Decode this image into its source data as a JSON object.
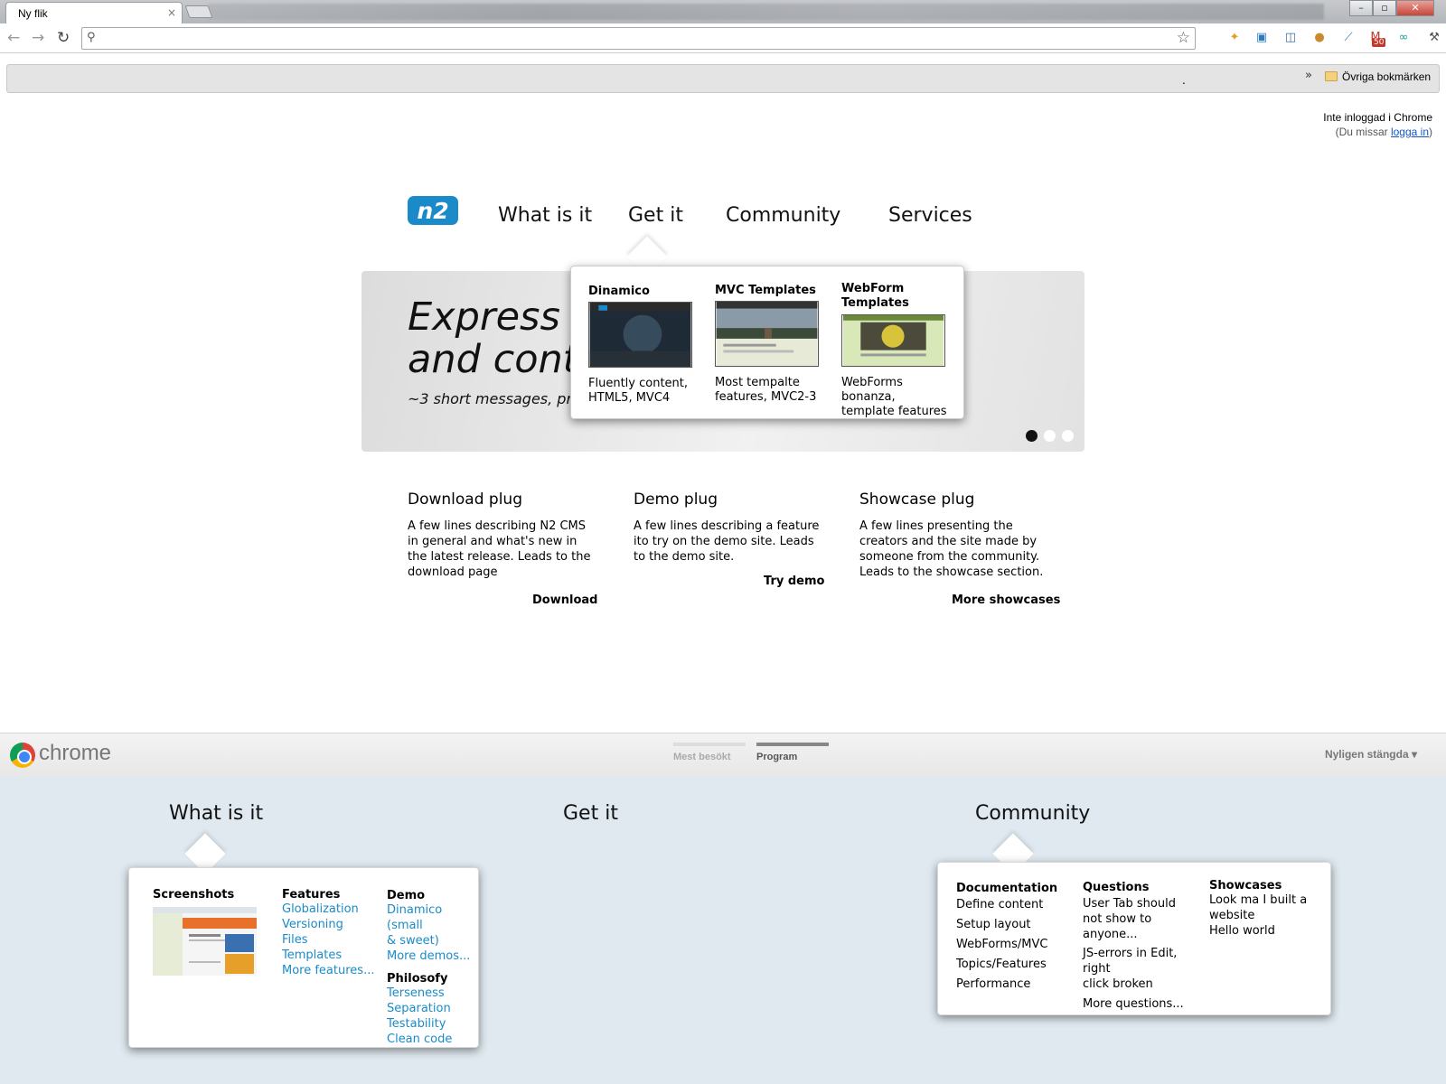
{
  "browser": {
    "tab_title": "Ny flik",
    "tab_close": "×",
    "window_buttons": {
      "minimize": "–",
      "maximize": "▫",
      "close": "✕"
    },
    "omnibox_value": "",
    "bookmarks": {
      "chevron": "»",
      "dot": ".",
      "other": "Övriga bokmärken"
    },
    "signin": {
      "line1": "Inte inloggad i Chrome",
      "line2_prefix": "(Du missar ",
      "link": "logga in",
      "line2_suffix": ")"
    },
    "extensions": [
      {
        "icon": "puzzle-icon",
        "color": "#e0a020"
      },
      {
        "icon": "screen-icon",
        "color": "#2a7cc7"
      },
      {
        "icon": "window-icon",
        "color": "#3a6ea5"
      },
      {
        "icon": "cookie-icon",
        "color": "#c98a2e"
      },
      {
        "icon": "eyedropper-icon",
        "color": "#3b7bbf"
      },
      {
        "icon": "gmail-icon",
        "color": "#c0392b",
        "badge": "50"
      },
      {
        "icon": "readlater-icon",
        "color": "#19a0a0"
      },
      {
        "icon": "wrench-icon",
        "color": "#555555"
      }
    ]
  },
  "mockup": {
    "logo_text": "n2",
    "nav": [
      "What is it",
      "Get it",
      "Community",
      "Services"
    ],
    "hero": {
      "title_line1": "Express y",
      "title_line2": "and cont",
      "subtitle": "~3 short messages, prob"
    },
    "get_it_menu": [
      {
        "title": "Dinamico",
        "text1": "Fluently content,",
        "text2": "HTML5, MVC4"
      },
      {
        "title": "MVC Templates",
        "text1": "Most tempalte",
        "text2": "features, MVC2-3"
      },
      {
        "title1": "WebForm",
        "title2": "Templates",
        "text1": "WebForms bonanza,",
        "text2": "template features"
      }
    ],
    "plugs": [
      {
        "title": "Download plug",
        "text": "A few lines describing N2 CMS in general and what's new in the latest release. Leads to the download page",
        "link": "Download"
      },
      {
        "title": "Demo plug",
        "text": "A few lines describing a feature ito try on the demo site. Leads to the demo site.",
        "link": "Try demo"
      },
      {
        "title": "Showcase plug",
        "text": "A few lines presenting the creators and the site made by someone from the community. Leads to the showcase section.",
        "link": "More showcases"
      }
    ]
  },
  "ntp": {
    "brand": "chrome",
    "tabs": [
      "Mest besökt",
      "Program"
    ],
    "recently_closed": "Nyligen stängda ▾"
  },
  "lower": {
    "nav": [
      "What is it",
      "Get it",
      "Community"
    ],
    "what_menu": {
      "screenshots": "Screenshots",
      "features_title": "Features",
      "features": [
        "Globalization",
        "Versioning",
        "Files",
        "Templates",
        "More features..."
      ],
      "demo_title": "Demo",
      "demo": [
        "Dinamico (small",
        "& sweet)",
        "More demos..."
      ],
      "philosofy_title": "Philosofy",
      "philosofy": [
        "Terseness",
        "Separation",
        "Testability",
        "Clean code"
      ]
    },
    "community_menu": {
      "doc_title": "Documentation",
      "docs": [
        "Define content",
        "Setup layout",
        "WebForms/MVC",
        "Topics/Features",
        "Performance"
      ],
      "q_title": "Questions",
      "questions": [
        "User Tab should",
        "not show to anyone...",
        "JS-errors in Edit, right",
        "click broken",
        "More questions..."
      ],
      "show_title": "Showcases",
      "showcases": [
        "Look ma I built a",
        "website",
        "Hello world"
      ]
    }
  }
}
